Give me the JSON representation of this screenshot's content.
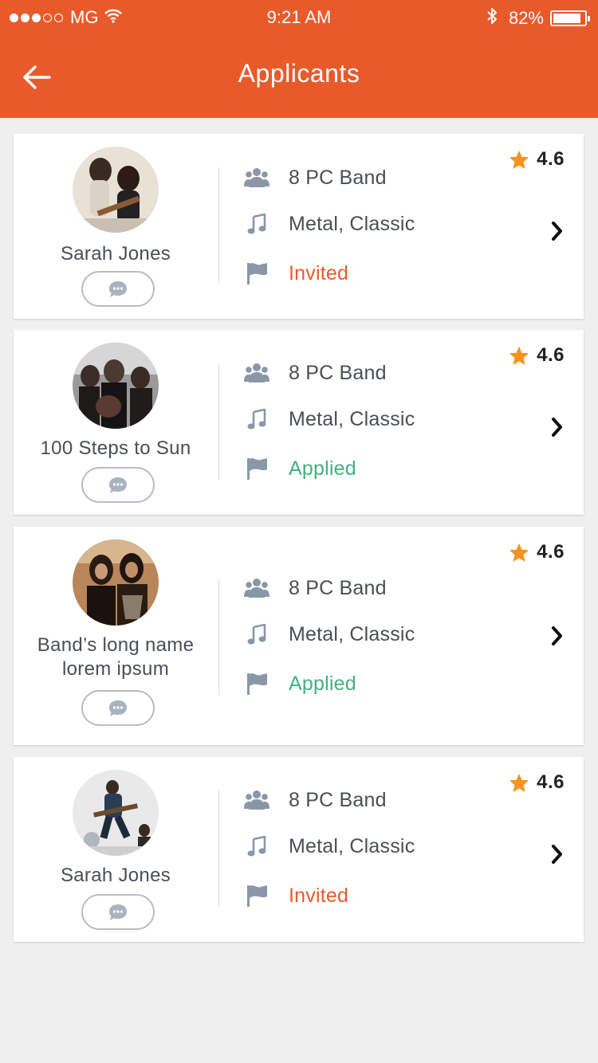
{
  "status_bar": {
    "carrier": "MG",
    "time": "9:21 AM",
    "battery": "82%",
    "battery_level": 0.82,
    "signal_dots_filled": 3,
    "signal_dots_total": 5
  },
  "header": {
    "title": "Applicants",
    "back_icon": "arrow-left-icon"
  },
  "colors": {
    "brand": "#e95a2b",
    "invited": "#e95a2b",
    "applied": "#43b080",
    "star": "#f7931e",
    "icon_gray": "#8a97a6"
  },
  "applicants": [
    {
      "name": "Sarah Jones",
      "rating": "4.6",
      "members": "8 PC Band",
      "genres": "Metal, Classic",
      "status": "Invited",
      "status_type": "invited"
    },
    {
      "name": "100 Steps to Sun",
      "rating": "4.6",
      "members": "8 PC Band",
      "genres": "Metal, Classic",
      "status": "Applied",
      "status_type": "applied"
    },
    {
      "name": "Band’s long name lorem ipsum",
      "rating": "4.6",
      "members": "8 PC Band",
      "genres": "Metal, Classic",
      "status": "Applied",
      "status_type": "applied"
    },
    {
      "name": "Sarah Jones",
      "rating": "4.6",
      "members": "8 PC Band",
      "genres": "Metal, Classic",
      "status": "Invited",
      "status_type": "invited"
    }
  ],
  "icons": {
    "members": "group-icon",
    "genres": "music-note-icon",
    "status": "flag-icon",
    "rating": "star-icon",
    "chat": "chat-bubble-icon",
    "open": "chevron-right-icon"
  }
}
